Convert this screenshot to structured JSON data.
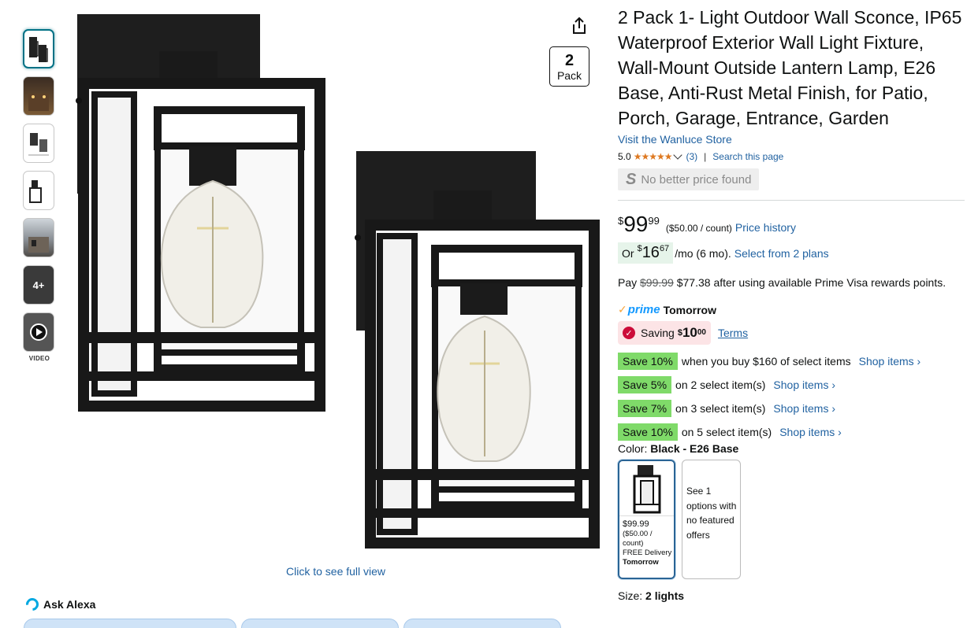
{
  "gallery": {
    "video_label": "VIDEO",
    "more_label": "4+",
    "full_view_link": "Click to see full view",
    "pack_badge": {
      "number": "2",
      "label": "Pack"
    }
  },
  "alexa": {
    "label": "Ask Alexa"
  },
  "product": {
    "title": "2 Pack 1- Light Outdoor Wall Sconce, IP65 Waterproof Exterior Wall Light Fixture, Wall-Mount Outside Lantern Lamp, E26 Base, Anti-Rust Metal Finish, for Patio, Porch, Garage, Entrance, Garden",
    "store_link": "Visit the Wanluce Store",
    "rating": "5.0",
    "stars": "★★★★★",
    "review_count": "(3)",
    "separator": "|",
    "search_page": "Search this page",
    "no_better_price": "No better price found",
    "no_better_price_icon": "S"
  },
  "price": {
    "currency": "$",
    "whole": "99",
    "fraction": "99",
    "per_unit": "($50.00 / count)",
    "history_link": "Price history"
  },
  "monthly": {
    "or": "Or",
    "currency": "$",
    "whole": "16",
    "fraction": "67",
    "suffix": "/mo (6 mo).",
    "plans_link": "Select from 2 plans"
  },
  "prime_visa": {
    "prefix": "Pay",
    "old_price": "$99.99",
    "new_price": "$77.38",
    "suffix": "after using available Prime Visa rewards points."
  },
  "delivery": {
    "check": "✓",
    "prime": "prime",
    "day": "Tomorrow"
  },
  "saving": {
    "icon": "✓",
    "label": "Saving",
    "currency": "$",
    "whole": "10",
    "fraction": "00",
    "terms_link": "Terms"
  },
  "promotions": [
    {
      "tag": "Save 10%",
      "text": "when you buy $160 of select items",
      "link": "Shop items ›"
    },
    {
      "tag": "Save 5%",
      "text": "on 2 select item(s)",
      "link": "Shop items ›"
    },
    {
      "tag": "Save 7%",
      "text": "on 3 select item(s)",
      "link": "Shop items ›"
    },
    {
      "tag": "Save 10%",
      "text": "on 5 select item(s)",
      "link": "Shop items ›"
    }
  ],
  "color": {
    "label": "Color:",
    "value": "Black - E26 Base",
    "swatch_selected": {
      "price": "$99.99",
      "unit": "($50.00 / count)",
      "delivery": "FREE Delivery",
      "day": "Tomorrow"
    },
    "swatch_other": {
      "text": "See 1 options with no featured offers"
    }
  },
  "size": {
    "label": "Size:",
    "value": "2 lights"
  },
  "colors": {
    "link": "#2162a1",
    "promo_green": "#7fda69",
    "prime_blue": "#1399ff",
    "saving_red": "#cc0c39"
  }
}
